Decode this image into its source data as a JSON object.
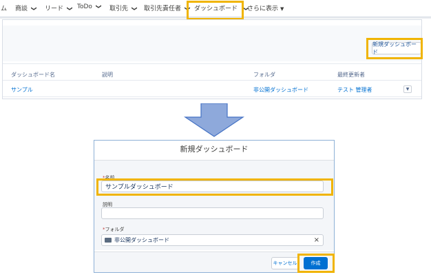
{
  "nav": {
    "items": [
      {
        "label": "ム"
      },
      {
        "label": "商談"
      },
      {
        "label": "リード"
      },
      {
        "label": "ToDo"
      },
      {
        "label": "取引先"
      },
      {
        "label": "取引先責任者"
      },
      {
        "label": "ダッシュボード"
      },
      {
        "label": "さらに表示"
      }
    ]
  },
  "list": {
    "new_button": "新規ダッシュボード",
    "columns": [
      "ダッシュボード名",
      "説明",
      "フォルダ",
      "最終更新者"
    ],
    "rows": [
      {
        "name": "サンプル",
        "description": "",
        "folder": "非公開ダッシュボード",
        "modified_by": "テスト 管理者"
      }
    ]
  },
  "modal": {
    "title": "新規ダッシュボード",
    "name_label": "名前",
    "name_value": "サンプルダッシュボード",
    "description_label": "説明",
    "description_value": "",
    "folder_label": "フォルダ",
    "folder_value": "非公開ダッシュボード",
    "clear_glyph": "×",
    "cancel_button": "キャンセル",
    "create_button": "作成",
    "required_mark": "*"
  },
  "colors": {
    "highlight": "#f0b400",
    "link": "#0070d2",
    "brand_button": "#0070d2",
    "arrow": "#8ea9db"
  },
  "icons": [
    "chevron-down-icon",
    "folder-icon",
    "clear-icon",
    "down-arrow-icon"
  ]
}
